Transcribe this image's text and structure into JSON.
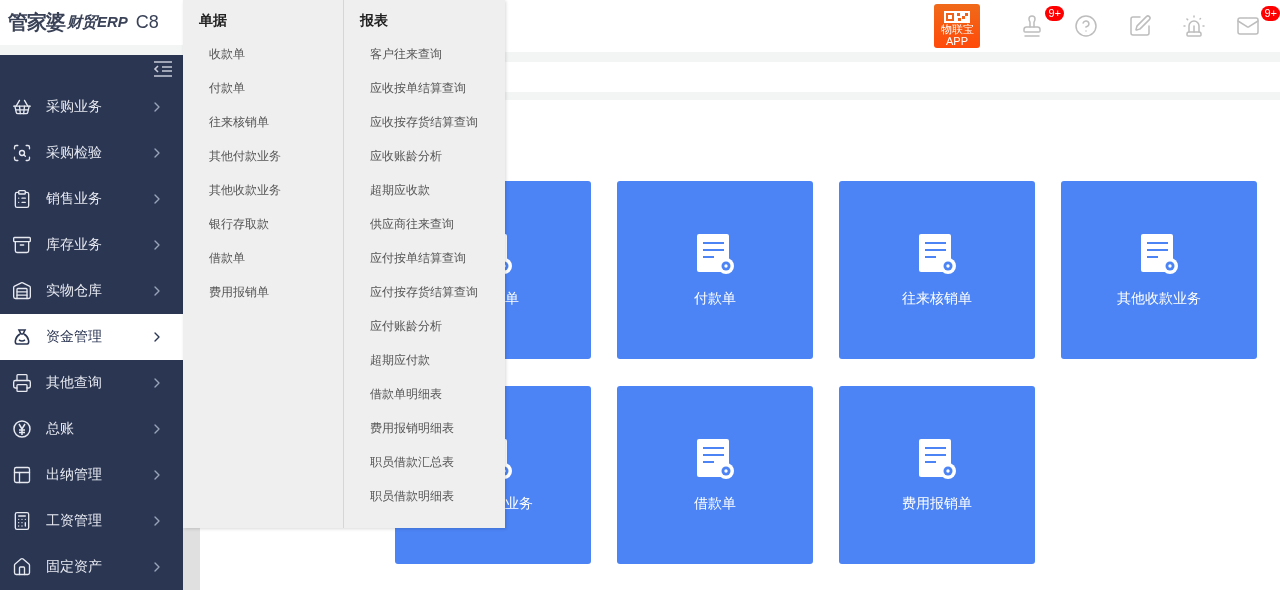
{
  "logo": {
    "brand": "管家婆",
    "product": "财贸ERP",
    "version": "C8"
  },
  "header": {
    "app_badge": {
      "line1": "物联宝",
      "line2": "APP"
    },
    "tools": [
      {
        "kind": "stamp",
        "badge": "9+"
      },
      {
        "kind": "help"
      },
      {
        "kind": "edit"
      },
      {
        "kind": "alarm"
      },
      {
        "kind": "mail",
        "badge": "9+"
      }
    ]
  },
  "sidebar": {
    "items": [
      {
        "label": "采购业务",
        "selected": false
      },
      {
        "label": "采购检验",
        "selected": false
      },
      {
        "label": "销售业务",
        "selected": false
      },
      {
        "label": "库存业务",
        "selected": false
      },
      {
        "label": "实物仓库",
        "selected": false
      },
      {
        "label": "资金管理",
        "selected": true
      },
      {
        "label": "其他查询",
        "selected": false
      },
      {
        "label": "总账",
        "selected": false
      },
      {
        "label": "出纳管理",
        "selected": false
      },
      {
        "label": "工资管理",
        "selected": false
      },
      {
        "label": "固定资产",
        "selected": false
      }
    ]
  },
  "flyout": {
    "columns": [
      {
        "title": "单据",
        "items": [
          "收款单",
          "付款单",
          "往来核销单",
          "其他付款业务",
          "其他收款业务",
          "银行存取款",
          "借款单",
          "费用报销单"
        ]
      },
      {
        "title": "报表",
        "items": [
          "客户往来查询",
          "应收按单结算查询",
          "应收按存货结算查询",
          "应收账龄分析",
          "超期应收款",
          "供应商往来查询",
          "应付按单结算查询",
          "应付按存货结算查询",
          "应付账龄分析",
          "超期应付款",
          "借款单明细表",
          "费用报销明细表",
          "职员借款汇总表",
          "职员借款明细表"
        ]
      }
    ]
  },
  "tiles": [
    {
      "label": "单",
      "kind": "partial"
    },
    {
      "label": "付款单",
      "kind": "full"
    },
    {
      "label": "往来核销单",
      "kind": "full"
    },
    {
      "label": "其他收款业务",
      "kind": "full"
    },
    {
      "label": "业务",
      "kind": "partial"
    },
    {
      "label": "借款单",
      "kind": "full"
    },
    {
      "label": "费用报销单",
      "kind": "full"
    }
  ]
}
